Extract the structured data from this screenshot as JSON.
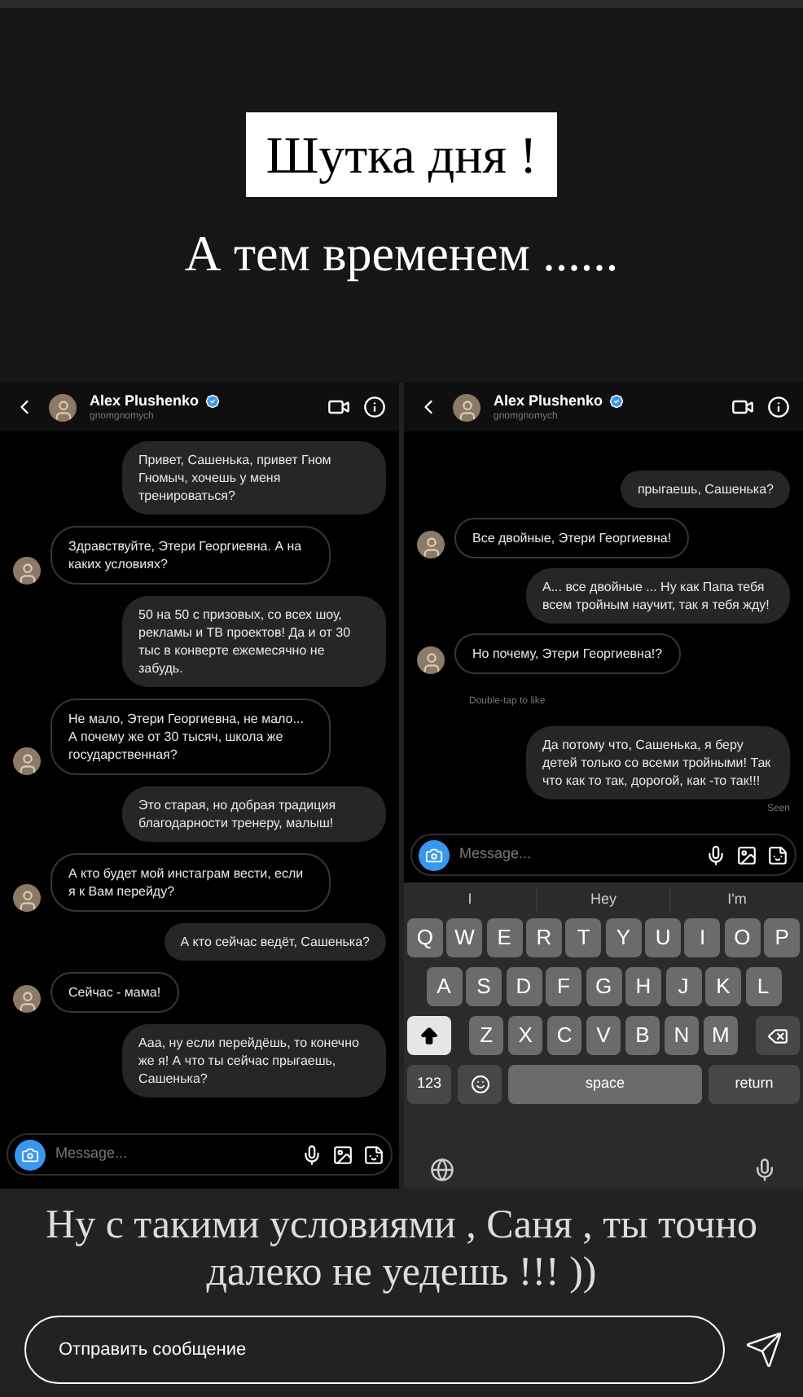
{
  "story": {
    "title": "Шутка дня !",
    "subtitle": "А тем временем ......"
  },
  "screenshots": [
    {
      "header": {
        "name": "Alex Plushenko",
        "username": "gnomgnomych"
      },
      "messages": [
        {
          "kind": "sent",
          "text": "Привет, Сашенька, привет Гном Гномыч, хочешь у меня тренироваться?"
        },
        {
          "kind": "received",
          "text": "Здравствуйте, Этери Георгиевна. А на каких условиях?"
        },
        {
          "kind": "sent",
          "text": "50 на 50 с призовых, со всех шоу, рекламы и ТВ проектов! Да и от 30 тыс в конверте ежемесячно не забудь."
        },
        {
          "kind": "received",
          "text": "Не мало, Этери Георгиевна, не мало... А почему же от 30 тысяч, школа же государственная?"
        },
        {
          "kind": "sent",
          "text": "Это старая, но добрая традиция благодарности тренеру, малыш!"
        },
        {
          "kind": "received",
          "text": "А кто будет мой инстаграм вести, если я к Вам перейду?"
        },
        {
          "kind": "sent",
          "text": "А кто сейчас ведёт, Сашенька?"
        },
        {
          "kind": "received",
          "text": "Сейчас - мама!"
        },
        {
          "kind": "sent",
          "text": "Ааа, ну если перейдёшь, то конечно же я! А что ты сейчас прыгаешь, Сашенька?"
        }
      ],
      "composer": {
        "placeholder": "Message..."
      }
    },
    {
      "header": {
        "name": "Alex Plushenko",
        "username": "gnomgnomych"
      },
      "messages": [
        {
          "kind": "sent",
          "text": "прыгаешь, Сашенька?"
        },
        {
          "kind": "received",
          "text": "Все двойные, Этери Георгиевна!"
        },
        {
          "kind": "sent",
          "text": "А... все двойные ... Ну как Папа тебя всем тройным научит, так я тебя жду!"
        },
        {
          "kind": "received",
          "text": "Но почему, Этери Георгиевна!?"
        },
        {
          "kind": "hint",
          "text": "Double-tap to like"
        },
        {
          "kind": "sent",
          "text": "Да потому что, Сашенька, я беру детей только со всеми тройными! Так что как то так, дорогой, как -то так!!!"
        },
        {
          "kind": "status",
          "text": "Seen"
        }
      ],
      "composer": {
        "placeholder": "Message..."
      },
      "keyboard": {
        "suggestions": [
          "I",
          "Hey",
          "I'm"
        ],
        "rows": [
          [
            {
              "kind": "letter",
              "label": "Q"
            },
            {
              "kind": "letter",
              "label": "W"
            },
            {
              "kind": "letter",
              "label": "E"
            },
            {
              "kind": "letter",
              "label": "R"
            },
            {
              "kind": "letter",
              "label": "T"
            },
            {
              "kind": "letter",
              "label": "Y"
            },
            {
              "kind": "letter",
              "label": "U"
            },
            {
              "kind": "letter",
              "label": "I"
            },
            {
              "kind": "letter",
              "label": "O"
            },
            {
              "kind": "letter",
              "label": "P"
            }
          ],
          [
            {
              "kind": "letter",
              "label": "A"
            },
            {
              "kind": "letter",
              "label": "S"
            },
            {
              "kind": "letter",
              "label": "D"
            },
            {
              "kind": "letter",
              "label": "F"
            },
            {
              "kind": "letter",
              "label": "G"
            },
            {
              "kind": "letter",
              "label": "H"
            },
            {
              "kind": "letter",
              "label": "J"
            },
            {
              "kind": "letter",
              "label": "K"
            },
            {
              "kind": "letter",
              "label": "L"
            }
          ],
          [
            {
              "kind": "shift",
              "on": true
            },
            {
              "kind": "letter",
              "label": "Z"
            },
            {
              "kind": "letter",
              "label": "X"
            },
            {
              "kind": "letter",
              "label": "C"
            },
            {
              "kind": "letter",
              "label": "V"
            },
            {
              "kind": "letter",
              "label": "B"
            },
            {
              "kind": "letter",
              "label": "N"
            },
            {
              "kind": "letter",
              "label": "M"
            },
            {
              "kind": "backspace"
            }
          ]
        ],
        "function_keys": [
          {
            "kind": "numbers",
            "label": "123"
          },
          {
            "kind": "emoji"
          },
          {
            "kind": "space",
            "label": "space"
          },
          {
            "kind": "return",
            "label": "return"
          }
        ]
      }
    }
  ],
  "caption": "Ну с такими условиями , Саня , ты точно далеко не уедешь !!! ))",
  "reply": {
    "placeholder": "Отправить сообщение"
  }
}
